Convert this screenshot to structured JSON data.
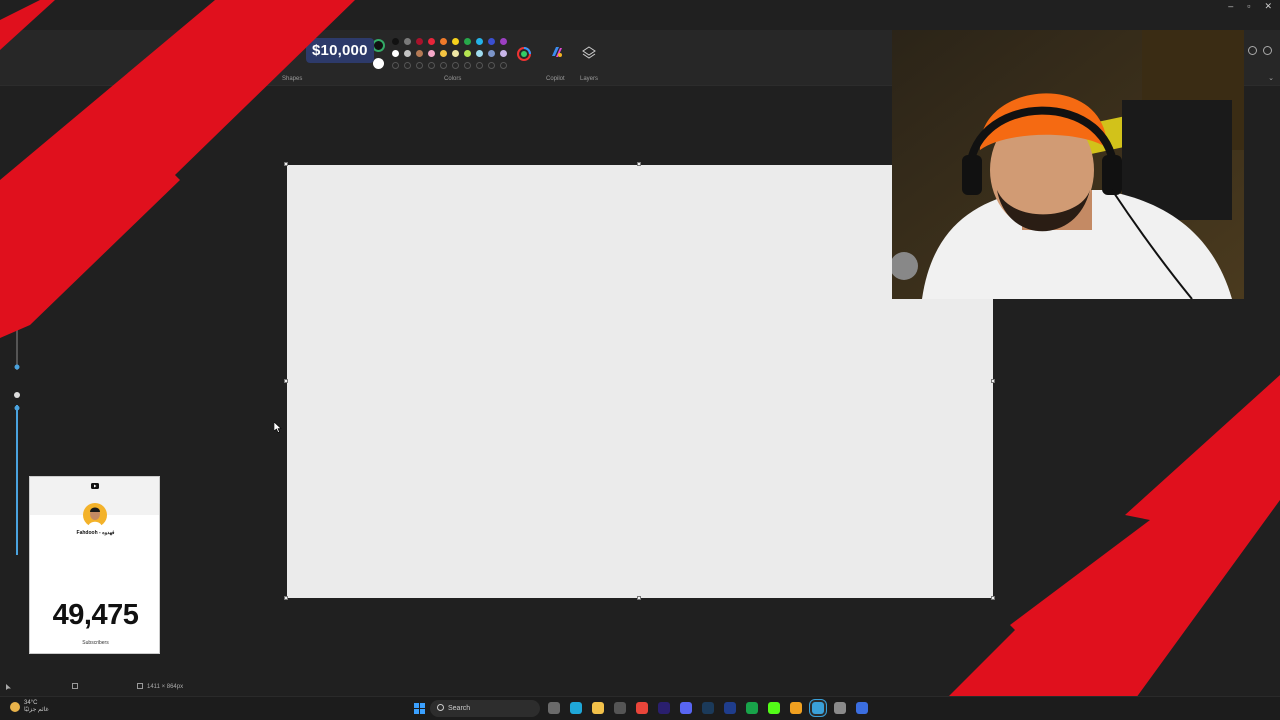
{
  "window": {
    "controls": [
      "–",
      "▫",
      "✕"
    ]
  },
  "ribbon": {
    "price_overlay": "$10,000",
    "groups": {
      "shapes": "Shapes",
      "colors": "Colors",
      "copilot": "Copilot",
      "layers": "Layers"
    },
    "colors": {
      "row1": [
        "#111111",
        "#7a7a7a",
        "#a8122b",
        "#e8253a",
        "#f07a2a",
        "#f6d21c",
        "#27a84a",
        "#25b3e8",
        "#3a4fd0",
        "#9c3fc2"
      ],
      "row2": [
        "#ffffff",
        "#c4c4c4",
        "#b57a55",
        "#f5a9c9",
        "#f5c542",
        "#f0e7a5",
        "#b5e551",
        "#9fdcf0",
        "#7c95c9",
        "#c8b5e8"
      ],
      "primary": "#111111",
      "secondary": "#ffffff"
    }
  },
  "subscriber_widget": {
    "channel_name": "Fahdooh - فهدوه",
    "count": "49,475",
    "label": "Subscribers"
  },
  "statusbar": {
    "canvas_size": "1411 × 864px"
  },
  "taskbar": {
    "weather_temp": "34°C",
    "weather_desc": "غائم جزئيًا",
    "search_placeholder": "Search",
    "apps": [
      "file-explorer",
      "edge",
      "folder",
      "capcut",
      "chrome",
      "premiere",
      "discord",
      "steam",
      "photoshop",
      "xbox",
      "kick",
      "chrome-alt",
      "paint",
      "settings",
      "roblox"
    ]
  }
}
